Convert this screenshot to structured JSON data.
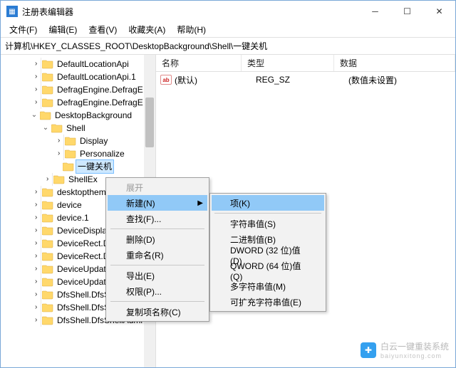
{
  "window": {
    "title": "注册表编辑器"
  },
  "menubar": [
    "文件(F)",
    "编辑(E)",
    "查看(V)",
    "收藏夹(A)",
    "帮助(H)"
  ],
  "address": "计算机\\HKEY_CLASSES_ROOT\\DesktopBackground\\Shell\\一键关机",
  "columns": {
    "name": "名称",
    "type": "类型",
    "data": "数据"
  },
  "values": [
    {
      "name": "(默认)",
      "type": "REG_SZ",
      "data": "(数值未设置)"
    }
  ],
  "tree": {
    "items": [
      "DefaultLocationApi",
      "DefaultLocationApi.1",
      "DefragEngine.DefragE",
      "DefragEngine.DefragE",
      "DesktopBackground",
      "Shell",
      "Display",
      "Personalize",
      "一键关机",
      "ShellEx",
      "desktopthemep",
      "device",
      "device.1",
      "DeviceDispla",
      "DeviceRect.D",
      "DeviceRect.D",
      "DeviceUpdat",
      "DeviceUpdat",
      "DfsShell.DfsS",
      "DfsShell.DfsShell.1",
      "DfsShell.DfsShellAdmi"
    ]
  },
  "context1": {
    "expand": "展开",
    "new": "新建(N)",
    "find": "查找(F)...",
    "delete": "删除(D)",
    "rename": "重命名(R)",
    "export": "导出(E)",
    "perm": "权限(P)...",
    "copyname": "复制项名称(C)"
  },
  "context2": {
    "key": "项(K)",
    "string": "字符串值(S)",
    "binary": "二进制值(B)",
    "dword": "DWORD (32 位)值(D)",
    "qword": "QWORD (64 位)值(Q)",
    "multi": "多字符串值(M)",
    "expand": "可扩充字符串值(E)"
  },
  "watermark": {
    "text": "白云一键重装系统",
    "sub": "baiyunxitong.com"
  }
}
